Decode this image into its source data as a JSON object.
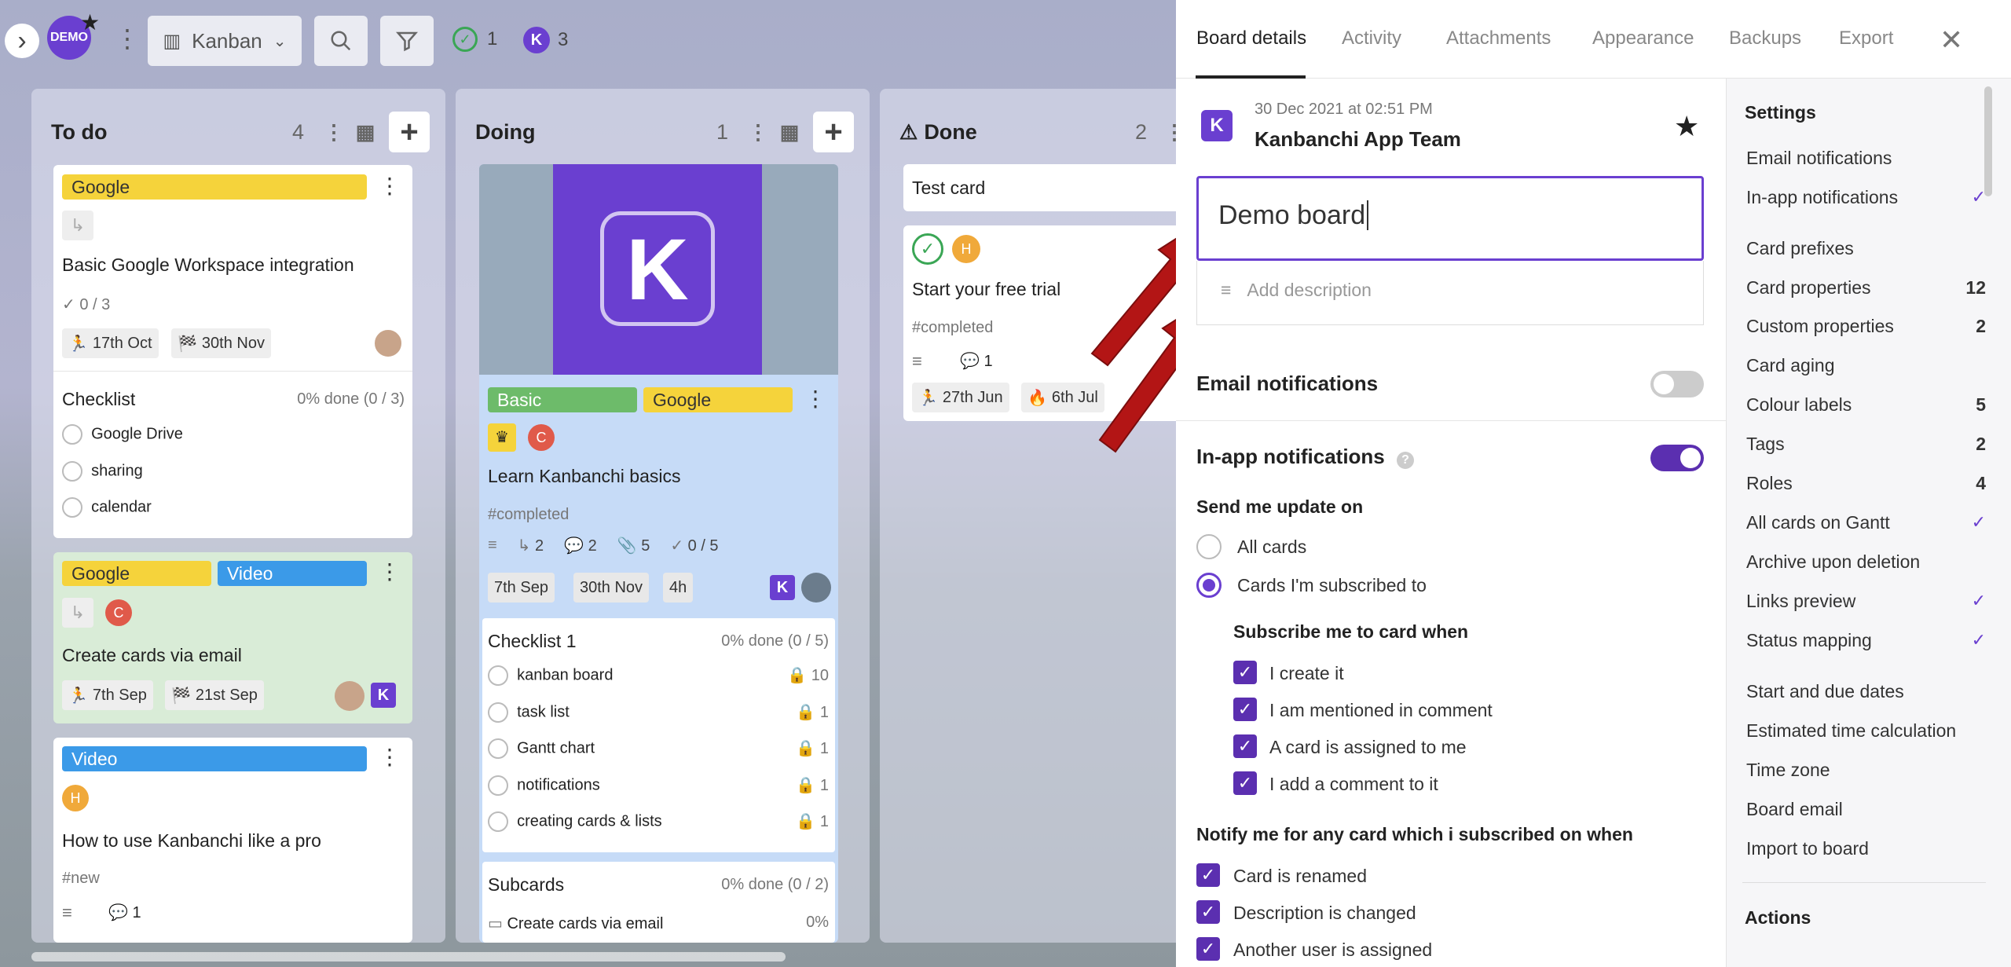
{
  "topbar": {
    "board_initials": "DEMO",
    "view_label": "Kanban",
    "done_count": "1",
    "team_count": "3",
    "expand_glyph": "›",
    "menu_glyph": "⋮"
  },
  "columns": {
    "todo": {
      "title": "To do",
      "count": "4"
    },
    "doing": {
      "title": "Doing",
      "count": "1"
    },
    "done": {
      "title": "Done",
      "count": "2"
    }
  },
  "todo_cards": {
    "c1": {
      "label": "Google",
      "title": "Basic Google Workspace integration",
      "checks": "0 / 3",
      "start": "17th Oct",
      "due": "30th Nov",
      "checklist_title": "Checklist",
      "checklist_progress": "0% done (0 / 3)",
      "items": [
        "Google Drive",
        "sharing",
        "calendar"
      ]
    },
    "c2": {
      "label1": "Google",
      "label2": "Video",
      "title": "Create cards via email",
      "start": "7th Sep",
      "due": "21st Sep"
    },
    "c3": {
      "label": "Video",
      "title": "How to use Kanbanchi like a pro",
      "tag": "#new",
      "comments": "1"
    }
  },
  "doing_card": {
    "label1": "Basic",
    "label2": "Google",
    "title": "Learn Kanbanchi basics",
    "tag": "#completed",
    "subcards": "2",
    "comments": "2",
    "attachments": "5",
    "checks": "0 / 5",
    "start": "7th Sep",
    "due": "30th Nov",
    "estimate": "4h",
    "checklist_title": "Checklist 1",
    "checklist_progress": "0% done (0 / 5)",
    "items": [
      {
        "name": "kanban board",
        "n": "10"
      },
      {
        "name": "task list",
        "n": "1"
      },
      {
        "name": "Gantt chart",
        "n": "1"
      },
      {
        "name": "notifications",
        "n": "1"
      },
      {
        "name": "creating cards & lists",
        "n": "1"
      }
    ],
    "subcards_title": "Subcards",
    "subcards_progress": "0% done (0 / 2)",
    "subcard_item": "Create cards via email",
    "subcard_pct": "0%"
  },
  "done_cards": {
    "c1": {
      "title": "Test card"
    },
    "c2": {
      "title": "Start your free trial",
      "tag": "#completed",
      "comments": "1",
      "start": "27th Jun",
      "due": "6th Jul"
    }
  },
  "panel": {
    "tabs": [
      "Board details",
      "Activity",
      "Attachments",
      "Appearance",
      "Backups",
      "Export"
    ],
    "date": "30 Dec 2021 at 02:51 PM",
    "team": "Kanbanchi App Team",
    "board_name": "Demo board",
    "desc_placeholder": "Add description",
    "email_notif": "Email notifications",
    "inapp_notif": "In-app notifications",
    "send_update": "Send me update on",
    "all_cards": "All cards",
    "subscribed_cards": "Cards I'm subscribed to",
    "subscribe_when": "Subscribe me to card when",
    "subscribe_opts": [
      "I create it",
      "I am mentioned in comment",
      "A card is assigned to me",
      "I add a comment to it"
    ],
    "notify_when": "Notify me for any card which i subscribed on when",
    "notify_opts": [
      "Card is renamed",
      "Description is changed",
      "Another user is assigned"
    ]
  },
  "settings": {
    "title": "Settings",
    "actions": "Actions",
    "items": [
      {
        "label": "Email notifications",
        "value": ""
      },
      {
        "label": "In-app notifications",
        "value": "✓"
      },
      {
        "label": "Card prefixes",
        "value": ""
      },
      {
        "label": "Card properties",
        "value": "12"
      },
      {
        "label": "Custom properties",
        "value": "2"
      },
      {
        "label": "Card aging",
        "value": ""
      },
      {
        "label": "Colour labels",
        "value": "5"
      },
      {
        "label": "Tags",
        "value": "2"
      },
      {
        "label": "Roles",
        "value": "4"
      },
      {
        "label": "All cards on Gantt",
        "value": "✓"
      },
      {
        "label": "Archive upon deletion",
        "value": ""
      },
      {
        "label": "Links preview",
        "value": "✓"
      },
      {
        "label": "Status mapping",
        "value": "✓"
      },
      {
        "label": "Start and due dates",
        "value": ""
      },
      {
        "label": "Estimated time calculation",
        "value": ""
      },
      {
        "label": "Time zone",
        "value": ""
      },
      {
        "label": "Board email",
        "value": ""
      },
      {
        "label": "Import to board",
        "value": ""
      }
    ]
  }
}
